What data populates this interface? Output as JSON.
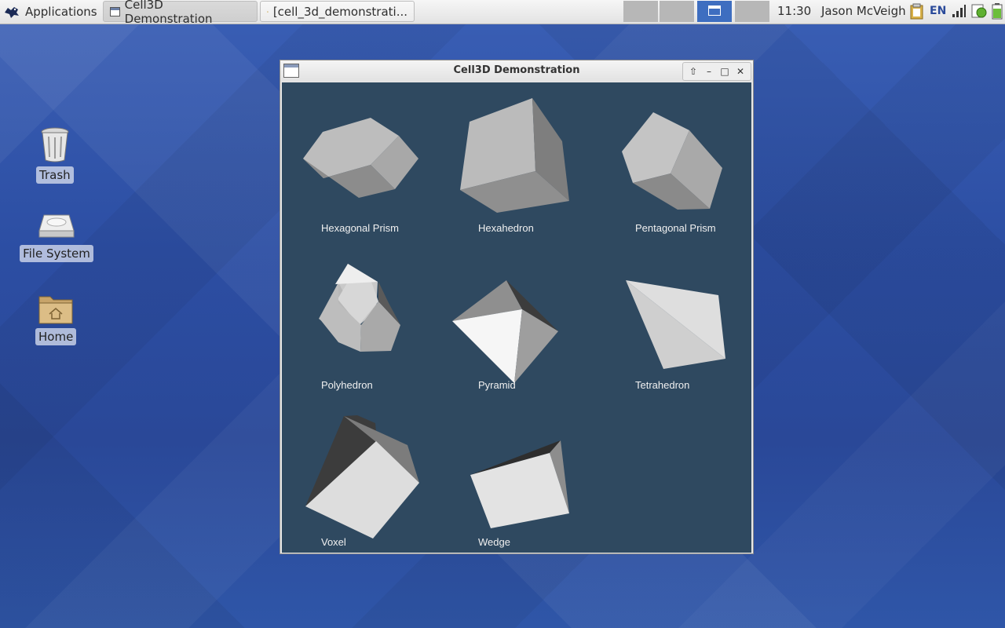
{
  "panel": {
    "applications_label": "Applications",
    "tasks": [
      {
        "label": "Cell3D Demonstration"
      },
      {
        "label": "[cell_3d_demonstrati..."
      }
    ],
    "clock": "11:30",
    "user": "Jason McVeigh",
    "keyboard_layout": "EN"
  },
  "desktop": {
    "icons": [
      {
        "label": "Trash",
        "icon": "trash-icon"
      },
      {
        "label": "File System",
        "icon": "drive-icon"
      },
      {
        "label": "Home",
        "icon": "home-folder-icon"
      }
    ]
  },
  "window": {
    "title": "Cell3D Demonstration",
    "background_color": "#2f4960",
    "cells": [
      {
        "label": "Hexagonal Prism"
      },
      {
        "label": "Hexahedron"
      },
      {
        "label": "Pentagonal Prism"
      },
      {
        "label": "Polyhedron"
      },
      {
        "label": "Pyramid"
      },
      {
        "label": "Tetrahedron"
      },
      {
        "label": "Voxel"
      },
      {
        "label": "Wedge"
      }
    ]
  }
}
